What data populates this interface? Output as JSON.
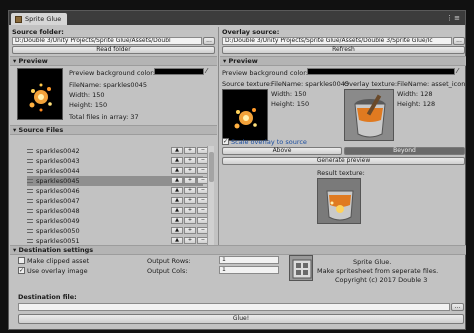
{
  "window": {
    "tab_title": "Sprite Glue",
    "menu_glyph": "⋮≡"
  },
  "source": {
    "folder_label": "Source folder:",
    "folder_path": "D:/Double 3/Unity Projects/Sprite Glue/Assets/Doubl",
    "browse_label": "...",
    "read_button": "Read folder",
    "preview_header": "Preview",
    "bg_color_label": "Preview background color:",
    "filename": "FileName: sparkles0045",
    "width": "Width: 150",
    "height": "Height: 150",
    "total_files": "Total files in array: 37",
    "files_header": "Source Files",
    "files": [
      "sparkles0042",
      "sparkles0043",
      "sparkles0044",
      "sparkles0045",
      "sparkles0046",
      "sparkles0047",
      "sparkles0048",
      "sparkles0049",
      "sparkles0050",
      "sparkles0051"
    ],
    "selected_index": 3,
    "row_btn_up": "▲",
    "row_btn_add": "+",
    "row_btn_remove": "−"
  },
  "overlay": {
    "source_label": "Overlay source:",
    "source_path": "D:/Double 3/Unity Projects/Sprite Glue/Assets/Double 3/Sprite Glue/Ic",
    "browse_label": "...",
    "refresh_button": "Refresh",
    "preview_header": "Preview",
    "bg_color_label": "Preview background color:",
    "source_texture_label": "Source texture:",
    "src_filename": "FileName: sparkles0045",
    "src_width": "Width: 150",
    "src_height": "Height: 150",
    "overlay_texture_label": "Overlay texture:",
    "ov_filename": "FileName: asset_icon",
    "ov_width": "Width: 128",
    "ov_height": "Height: 128",
    "scale_overlay_label": "Scale overlay to source",
    "above_button": "Above",
    "beyond_button": "Beyond",
    "generate_button": "Generate preview",
    "result_label": "Result texture:"
  },
  "destination": {
    "settings_header": "Destination settings",
    "make_clipped": "Make clipped asset",
    "use_overlay": "Use overlay image",
    "output_rows_label": "Output Rows:",
    "output_rows": "1",
    "output_cols_label": "Output Cols:",
    "output_cols": "1",
    "about_title": "Sprite Glue.",
    "about_desc": "Make spritesheet from seperate files.",
    "about_copy": "Copyright (c) 2017 Double 3",
    "folder_label": "Destination file:",
    "folder_path": "",
    "browse_label": "...",
    "glue_button": "Glue!"
  }
}
